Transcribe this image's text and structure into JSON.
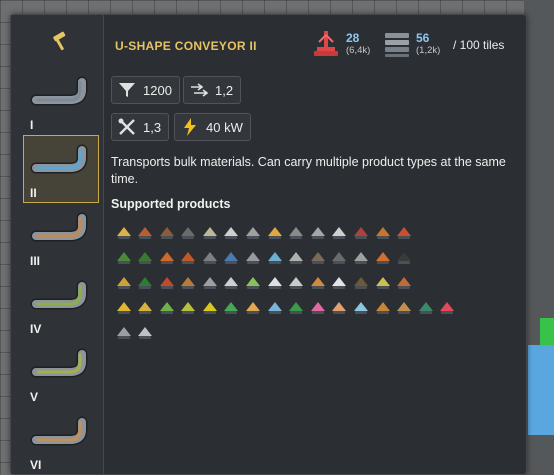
{
  "building": {
    "title": "U-SHAPE CONVEYOR II",
    "cost_primary": {
      "value": "28",
      "sub": "(6,4k)",
      "icon": "crane-icon",
      "color": "#e04646"
    },
    "cost_secondary": {
      "value": "56",
      "sub": "(1,2k)",
      "icon": "steel-stack-icon"
    },
    "tiles_label": "/ 100 tiles"
  },
  "sidebar": {
    "tool_icon": "hammer-icon",
    "variants": [
      {
        "label": "I",
        "color": "#7d8a99",
        "selected": false
      },
      {
        "label": "II",
        "color": "#5aa6d6",
        "selected": true
      },
      {
        "label": "III",
        "color": "#c28a55",
        "selected": false
      },
      {
        "label": "IV",
        "color": "#8bb04a",
        "selected": false
      },
      {
        "label": "V",
        "color": "#a6b04a",
        "selected": false
      },
      {
        "label": "VI",
        "color": "#c2905a",
        "selected": false
      }
    ]
  },
  "stats": {
    "throughput": {
      "icon": "funnel-icon",
      "value": "1200"
    },
    "speed": {
      "icon": "speed-arrows-icon",
      "value": "1,2"
    },
    "maintenance": {
      "icon": "wrench-screwdriver-icon",
      "value": "1,3"
    },
    "power": {
      "icon": "lightning-icon",
      "value": "40 kW"
    }
  },
  "description": "Transports bulk materials. Can carry multiple product types at the same time.",
  "products_title": "Supported products",
  "accent_gold": "#e7c463",
  "accent_blue": "#8ec7f2",
  "products": [
    [
      "#d9b24a",
      "#b75f2f",
      "#8f5b3a",
      "#6b6b6b",
      "#bfb79a",
      "#cfcfcf",
      "#a0a0a0",
      "#e0a640",
      "#8a8a8a",
      "#a6a6a6",
      "#d0d0d0",
      "#b04040",
      "#c8762a",
      "#c85030"
    ],
    [
      "#4a8a3a",
      "#3a7a2e",
      "#d06a2a",
      "#c05828",
      "#7f7f7f",
      "#4a7ab0",
      "#9a9a9a",
      "#6ab0d0",
      "#b0b0b0",
      "#7a6a5a",
      "#6a6a6a",
      "#a0a0a0",
      "#d07030",
      "#3a3a3a"
    ],
    [
      "#c9a23a",
      "#2f7a34",
      "#c04a2a",
      "#b87a3a",
      "#9aa0a6",
      "#cfcfd2",
      "#8ac05a",
      "#e0e0e0",
      "#cccccc",
      "#d08a3a",
      "#e4e4e4",
      "#6a5a3a",
      "#c8c050",
      "#c06a3a"
    ],
    [
      "#e0b830",
      "#d8b040",
      "#70b04a",
      "#b8c040",
      "#d8c820",
      "#48a85a",
      "#e0a850",
      "#7ab4d8",
      "#3a9a4a",
      "#e06aa0",
      "#e0a070",
      "#8ac8e0",
      "#c8843a",
      "#c09050",
      "#3a8a6a",
      "#e04a5a"
    ],
    [
      "#9aa0a6",
      "#bcc2c8"
    ]
  ]
}
